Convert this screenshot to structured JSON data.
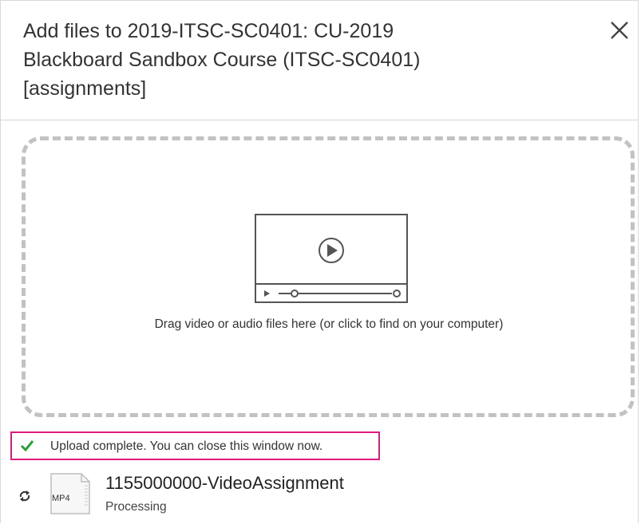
{
  "dialog": {
    "title": "Add files to 2019-ITSC-SC0401: CU-2019 Blackboard Sandbox Course (ITSC-SC0401) [assignments]",
    "close_icon": "close-icon"
  },
  "dropzone": {
    "illustration_icon": "video-player-icon",
    "instruction": "Drag video or audio files here (or click to find on your computer)"
  },
  "status": {
    "icon": "checkmark-icon",
    "message": "Upload complete. You can close this window now.",
    "highlight_color": "#e0197d",
    "success_color": "#2e9d3a"
  },
  "file": {
    "refresh_icon": "refresh-icon",
    "type_badge": "MP4",
    "name": "1155000000-VideoAssignment",
    "status": "Processing"
  }
}
